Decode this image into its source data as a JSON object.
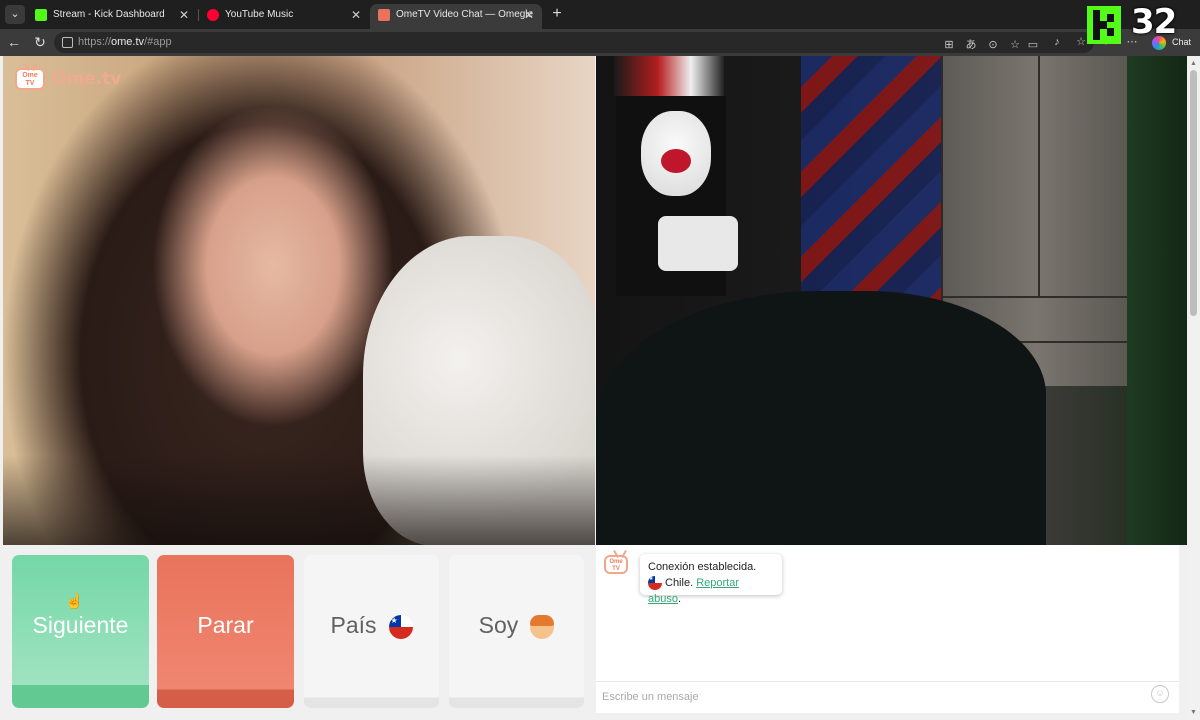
{
  "browser": {
    "tabs": [
      {
        "title": "Stream - Kick Dashboard",
        "favicon_color": "#53fc18"
      },
      {
        "title": "YouTube Music",
        "favicon_color": "#ff0033"
      },
      {
        "title": "OmeTV Video Chat — Omegle",
        "favicon_color": "#e9735c"
      }
    ],
    "close_glyph": "✕",
    "new_tab_glyph": "+",
    "url_prefix": "https://",
    "url_host": "ome.tv",
    "url_path": "/#app",
    "chat_label": "Chat"
  },
  "overlay": {
    "viewer_count": "32"
  },
  "app": {
    "logo_text": "Ome.tv",
    "logo_icon_text": "Ome TV"
  },
  "buttons": {
    "next_label": "Siguiente",
    "stop_label": "Parar",
    "country_label": "País",
    "gender_label": "Soy"
  },
  "chat": {
    "status_line1": "Conexión establecida.",
    "country_name": "Chile.",
    "report_link": "Reportar abuso",
    "report_suffix": ".",
    "input_placeholder": "Escribe un mensaje"
  },
  "colors": {
    "next_button": "#74d7a6",
    "stop_button": "#e9735c",
    "kick_green": "#53fc18",
    "link_green": "#36a878"
  }
}
